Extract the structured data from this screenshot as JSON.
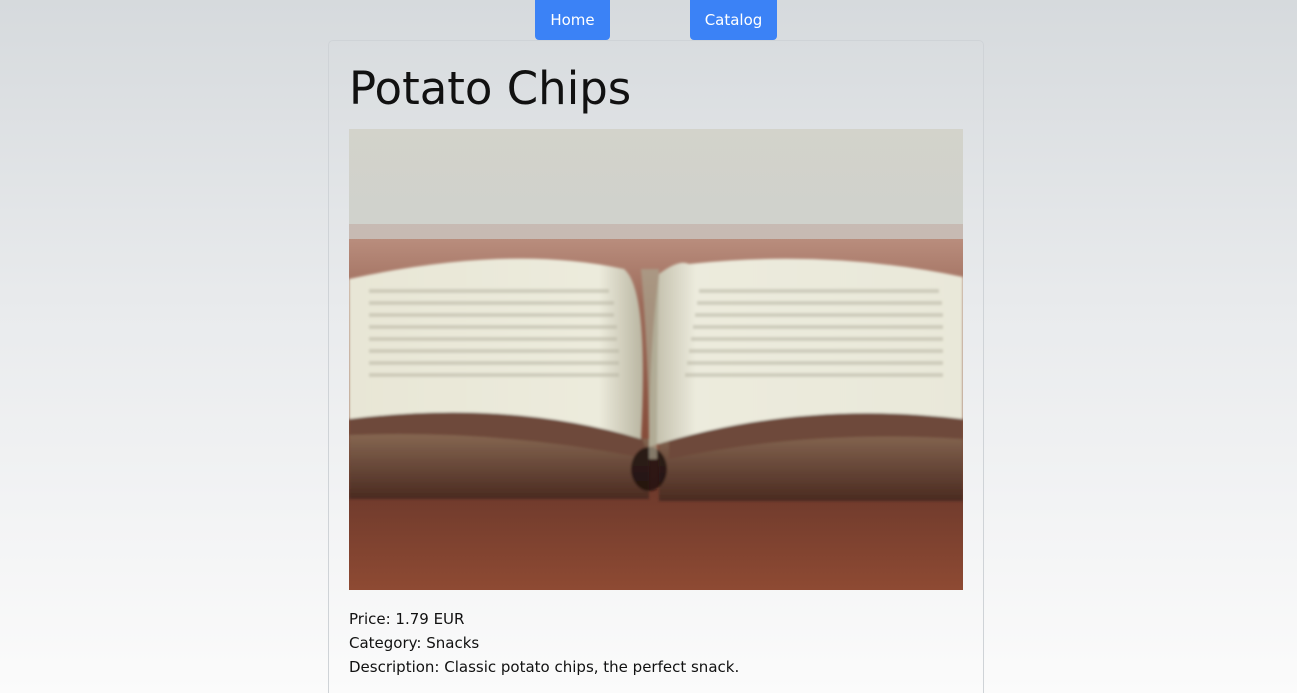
{
  "nav": {
    "home_label": "Home",
    "catalog_label": "Catalog"
  },
  "product": {
    "title": "Potato Chips",
    "image_alt": "open book on wooden table",
    "price_label": "Price: 1.79 EUR",
    "category_label": "Category: Snacks",
    "description_label": "Description: Classic potato chips, the perfect snack."
  },
  "colors": {
    "accent": "#3b82f6"
  }
}
